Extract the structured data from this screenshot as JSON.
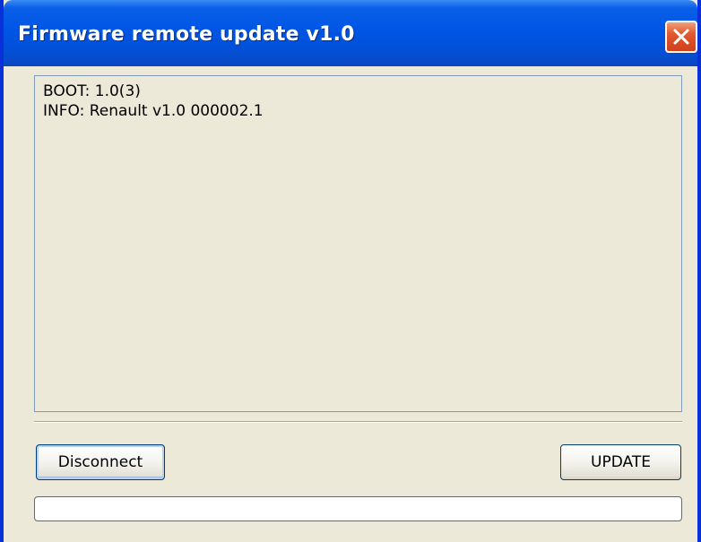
{
  "window": {
    "title": "Firmware remote update v1.0",
    "close_icon": "close-icon"
  },
  "log": {
    "lines": [
      "BOOT: 1.0(3)",
      "INFO: Renault v1.0 000002.1"
    ]
  },
  "buttons": {
    "disconnect_label": "Disconnect",
    "update_label": "UPDATE"
  },
  "progress": {
    "value": 0
  },
  "colors": {
    "titlebar": "#0055E5",
    "close": "#E2582F",
    "face": "#ECE9D8"
  }
}
